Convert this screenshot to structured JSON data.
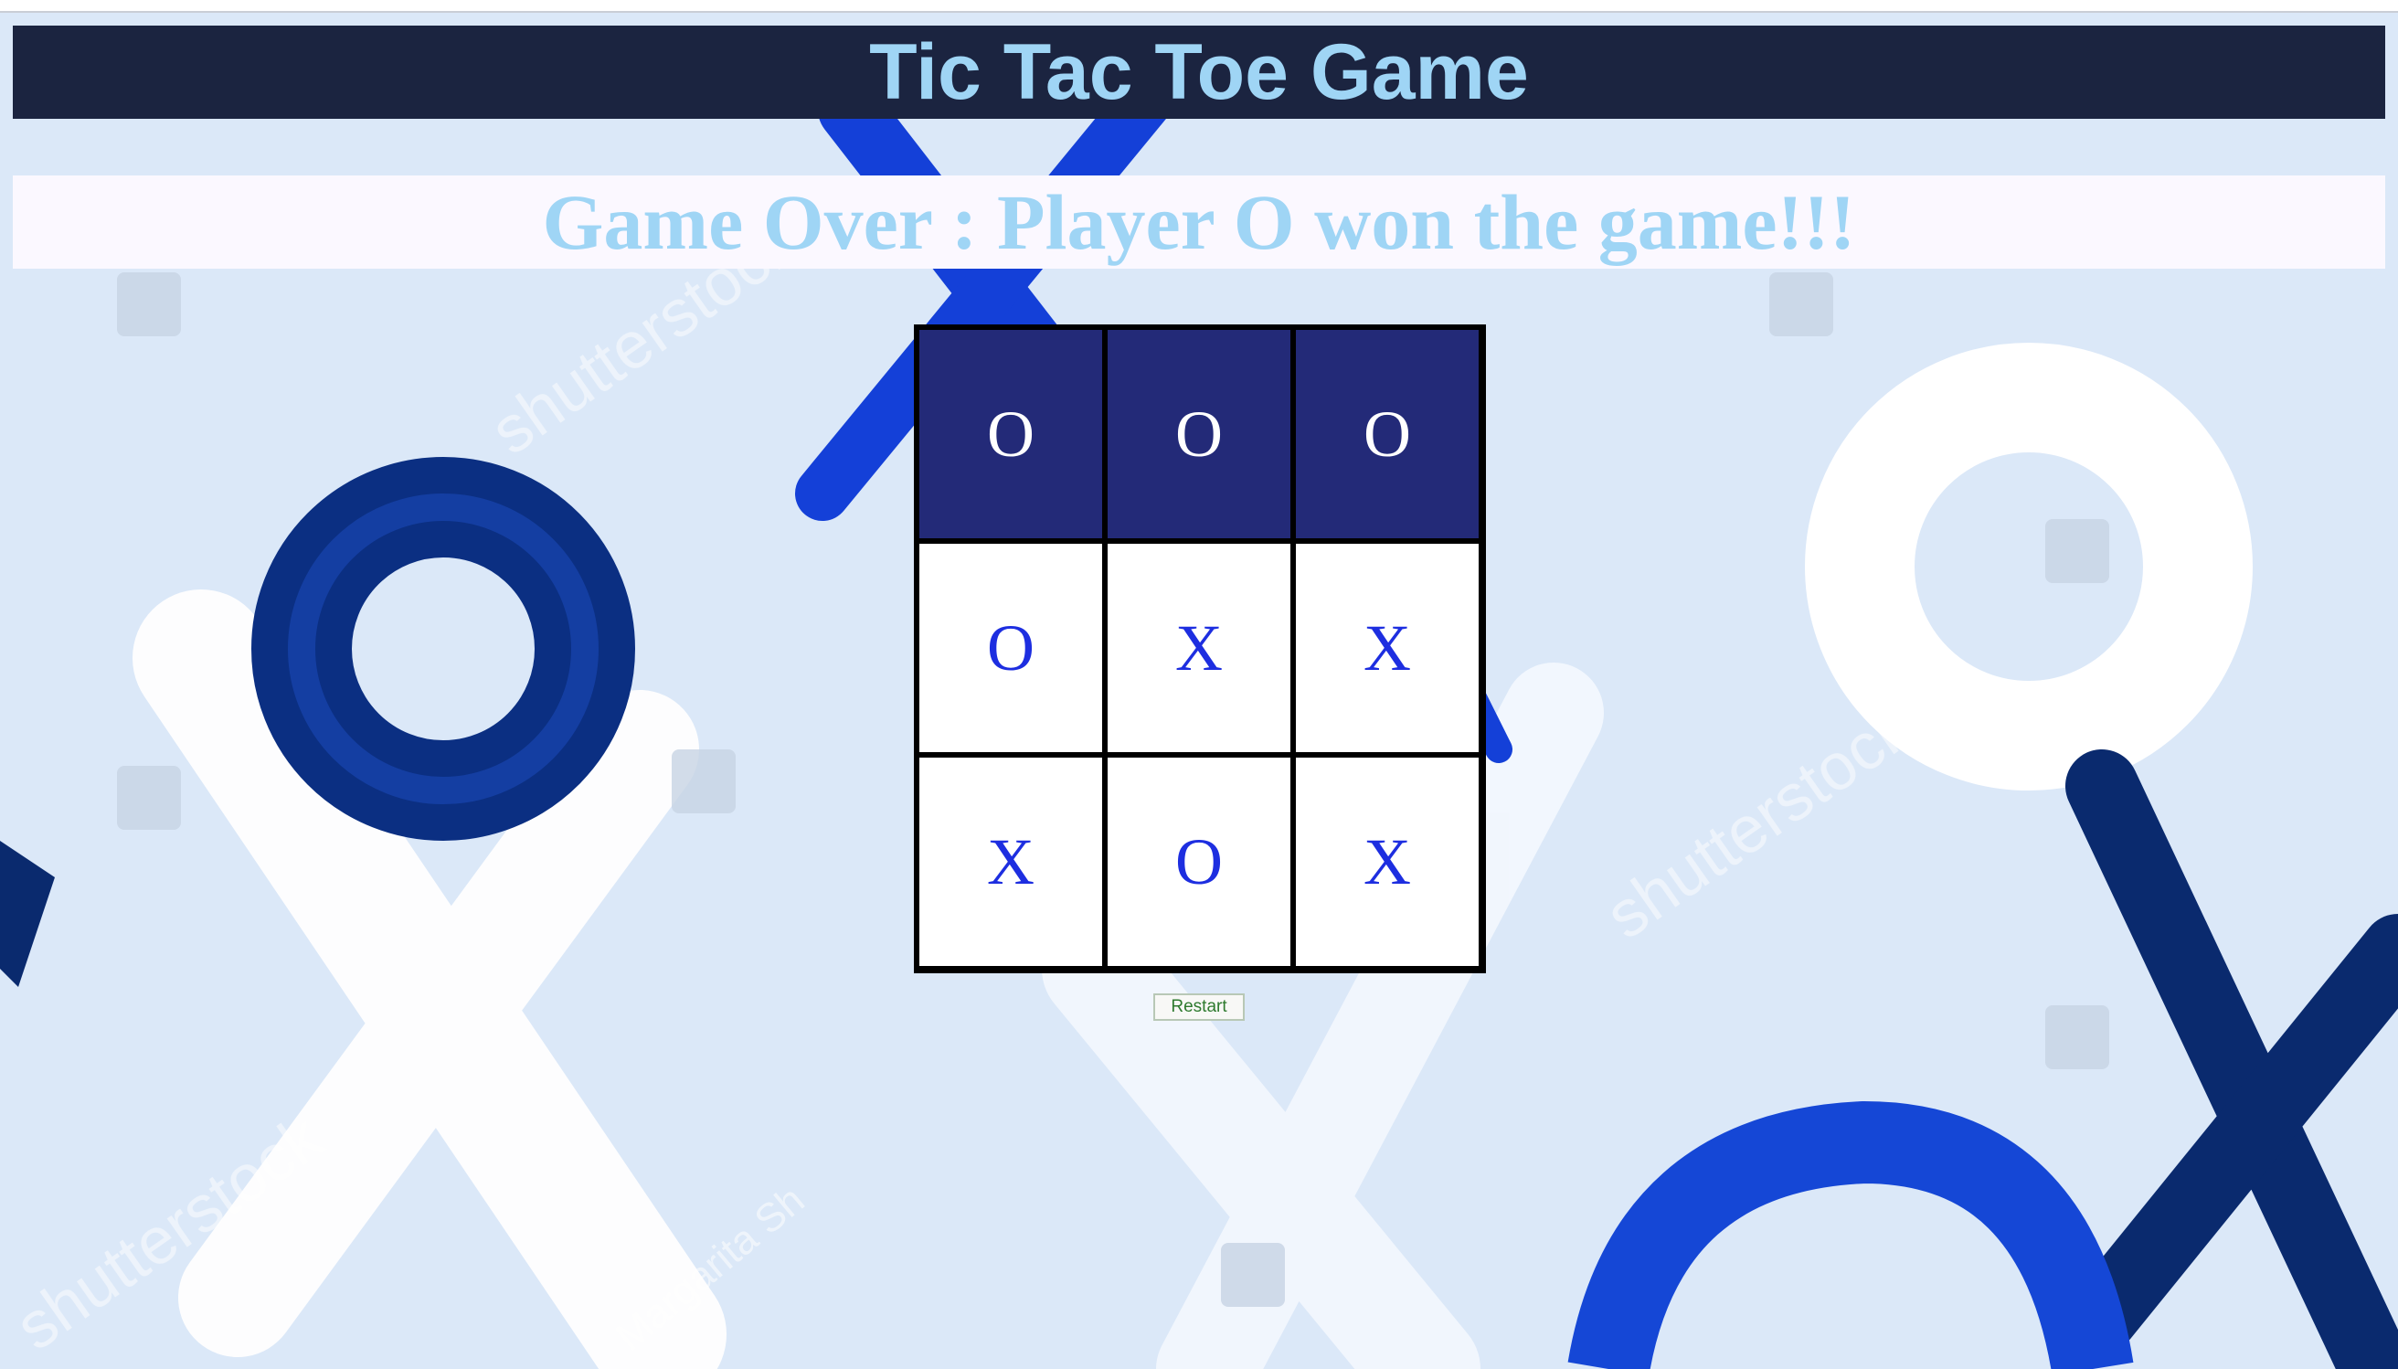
{
  "header": {
    "title": "Tic Tac Toe Game"
  },
  "status": {
    "message": "Game Over : Player O won the game!!!"
  },
  "board": {
    "cells": [
      "O",
      "O",
      "O",
      "O",
      "X",
      "X",
      "X",
      "O",
      "X"
    ],
    "winning_cells": [
      0,
      1,
      2
    ]
  },
  "controls": {
    "restart_label": "Restart"
  },
  "colors": {
    "header_bg": "#1b2440",
    "title_text": "#9fd5f5",
    "status_bg": "#fbf8ff",
    "win_cell_bg": "#232a78",
    "mark_color": "#1d2ee0"
  },
  "background": {
    "watermark_text": "shutterstock",
    "artist_credit": "Margarita Sh"
  }
}
